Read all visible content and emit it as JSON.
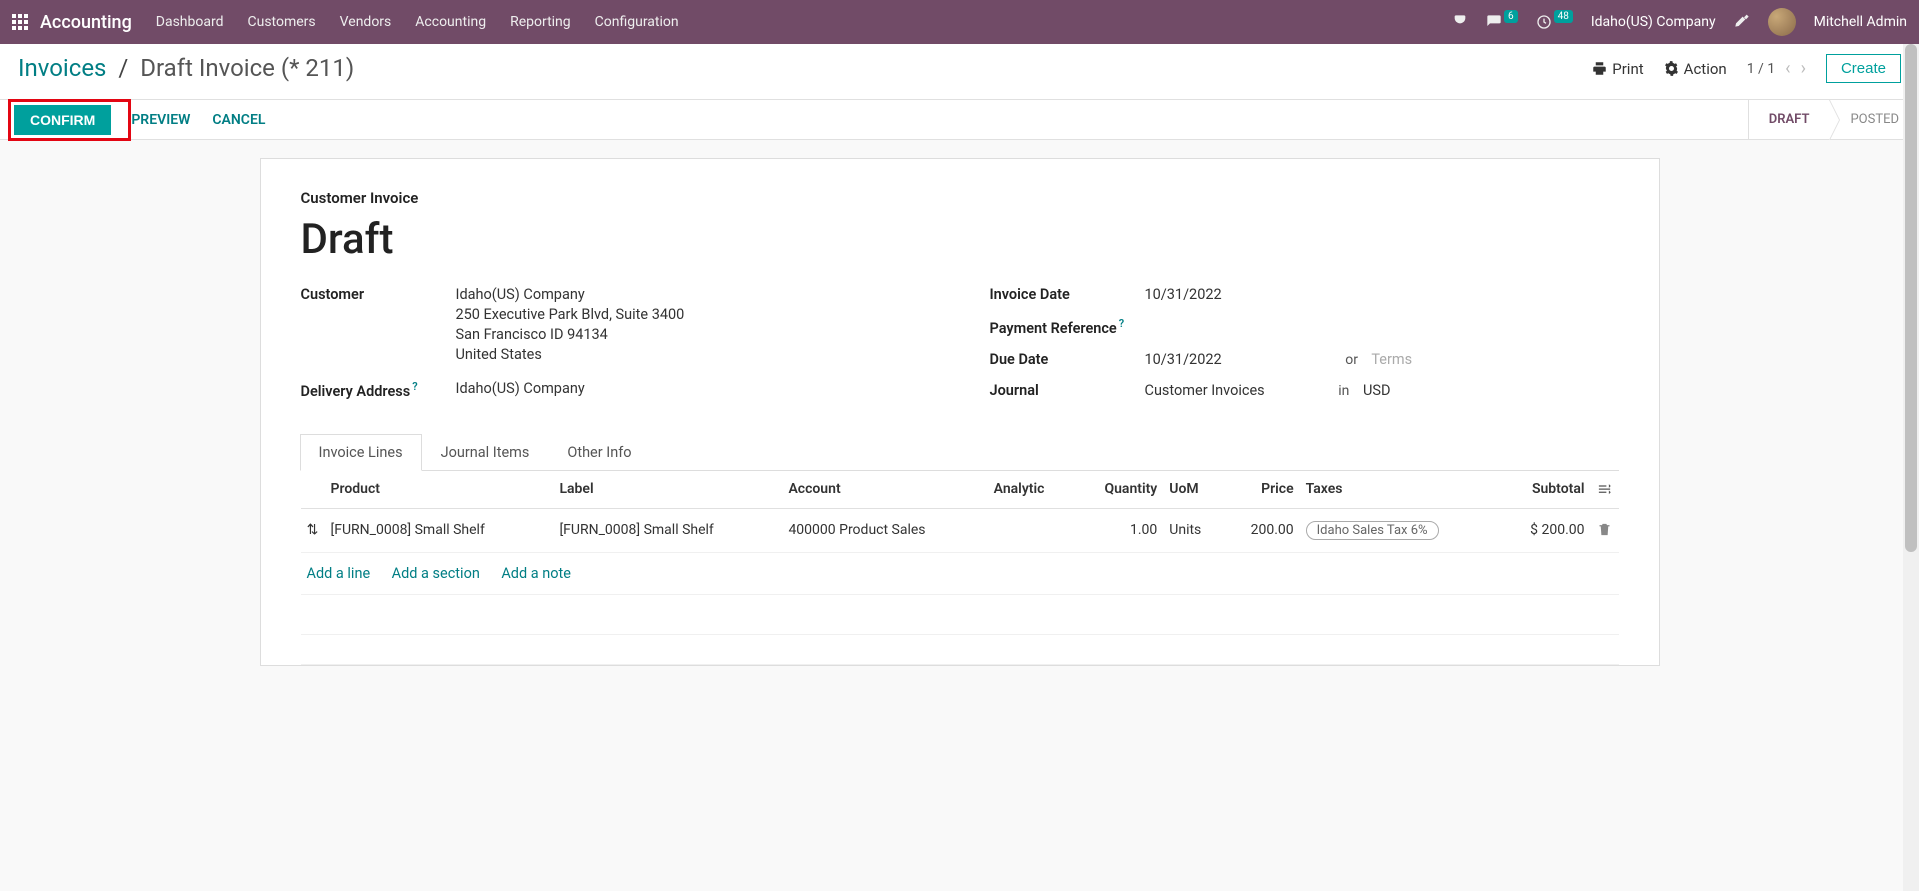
{
  "navbar": {
    "brand": "Accounting",
    "menu": [
      "Dashboard",
      "Customers",
      "Vendors",
      "Accounting",
      "Reporting",
      "Configuration"
    ],
    "msg_badge": "6",
    "timer_badge": "48",
    "company": "Idaho(US) Company",
    "user": "Mitchell Admin"
  },
  "breadcrumb": {
    "root": "Invoices",
    "current": "Draft Invoice (* 211)"
  },
  "control": {
    "print": "Print",
    "action": "Action",
    "pager": "1 / 1",
    "create": "Create"
  },
  "status": {
    "confirm": "CONFIRM",
    "preview": "PREVIEW",
    "cancel": "CANCEL",
    "draft": "DRAFT",
    "posted": "POSTED"
  },
  "doc": {
    "type": "Customer Invoice",
    "title": "Draft",
    "customer_label": "Customer",
    "customer_name": "Idaho(US) Company",
    "addr1": "250 Executive Park Blvd, Suite 3400",
    "addr2": "San Francisco ID 94134",
    "addr3": "United States",
    "delivery_label": "Delivery Address",
    "delivery_value": "Idaho(US) Company",
    "invoice_date_label": "Invoice Date",
    "invoice_date": "10/31/2022",
    "payment_ref_label": "Payment Reference",
    "due_date_label": "Due Date",
    "due_date": "10/31/2022",
    "or_label": "or",
    "terms_placeholder": "Terms",
    "journal_label": "Journal",
    "journal_value": "Customer Invoices",
    "in_label": "in",
    "currency": "USD"
  },
  "tabs": {
    "invoice_lines": "Invoice Lines",
    "journal_items": "Journal Items",
    "other_info": "Other Info"
  },
  "table": {
    "headers": {
      "product": "Product",
      "label": "Label",
      "account": "Account",
      "analytic": "Analytic",
      "quantity": "Quantity",
      "uom": "UoM",
      "price": "Price",
      "taxes": "Taxes",
      "subtotal": "Subtotal"
    },
    "row": {
      "product": "[FURN_0008] Small Shelf",
      "label": "[FURN_0008] Small Shelf",
      "account": "400000 Product Sales",
      "analytic": "",
      "quantity": "1.00",
      "uom": "Units",
      "price": "200.00",
      "tax": "Idaho Sales Tax 6%",
      "subtotal": "$ 200.00"
    },
    "actions": {
      "add_line": "Add a line",
      "add_section": "Add a section",
      "add_note": "Add a note"
    }
  }
}
